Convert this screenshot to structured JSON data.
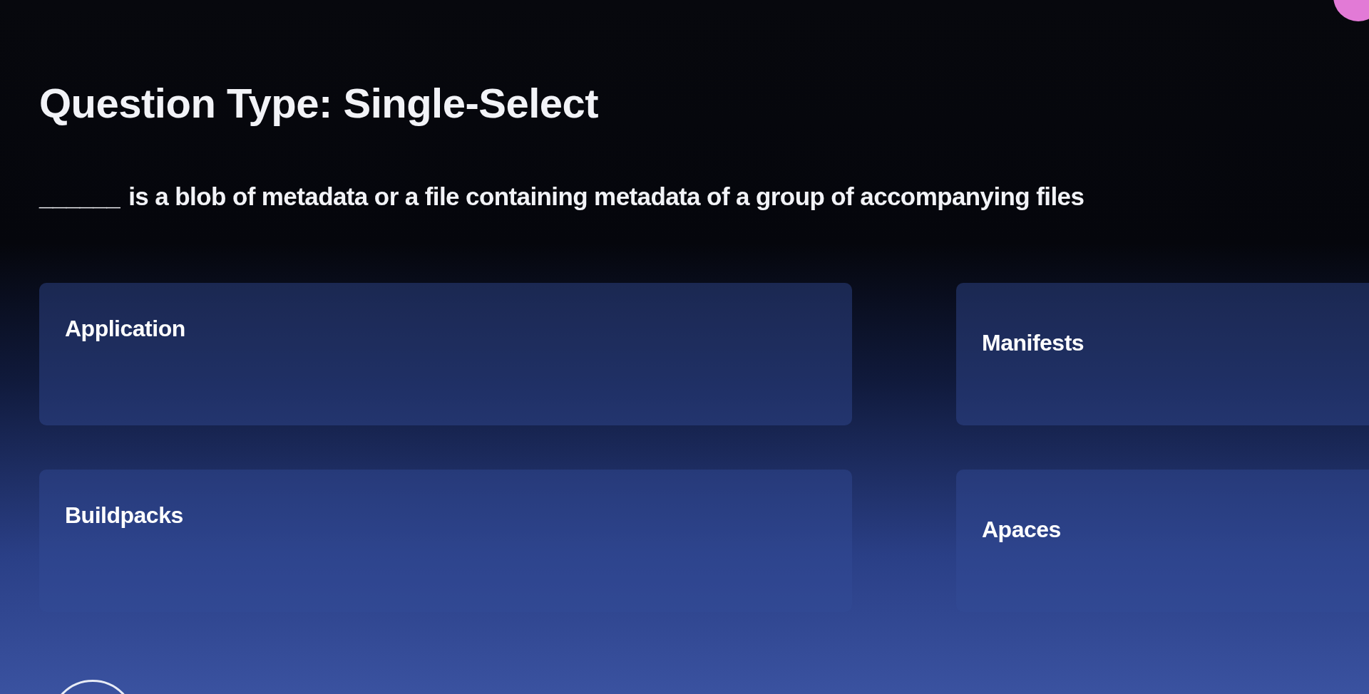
{
  "question_type": "Question Type: Single-Select",
  "question": {
    "blank": "______",
    "text": "is a blob of metadata or a file containing metadata of a group of accompanying files"
  },
  "options": [
    {
      "label": "Application"
    },
    {
      "label": "Manifests"
    },
    {
      "label": "Buildpacks"
    },
    {
      "label": "Apaces"
    }
  ]
}
